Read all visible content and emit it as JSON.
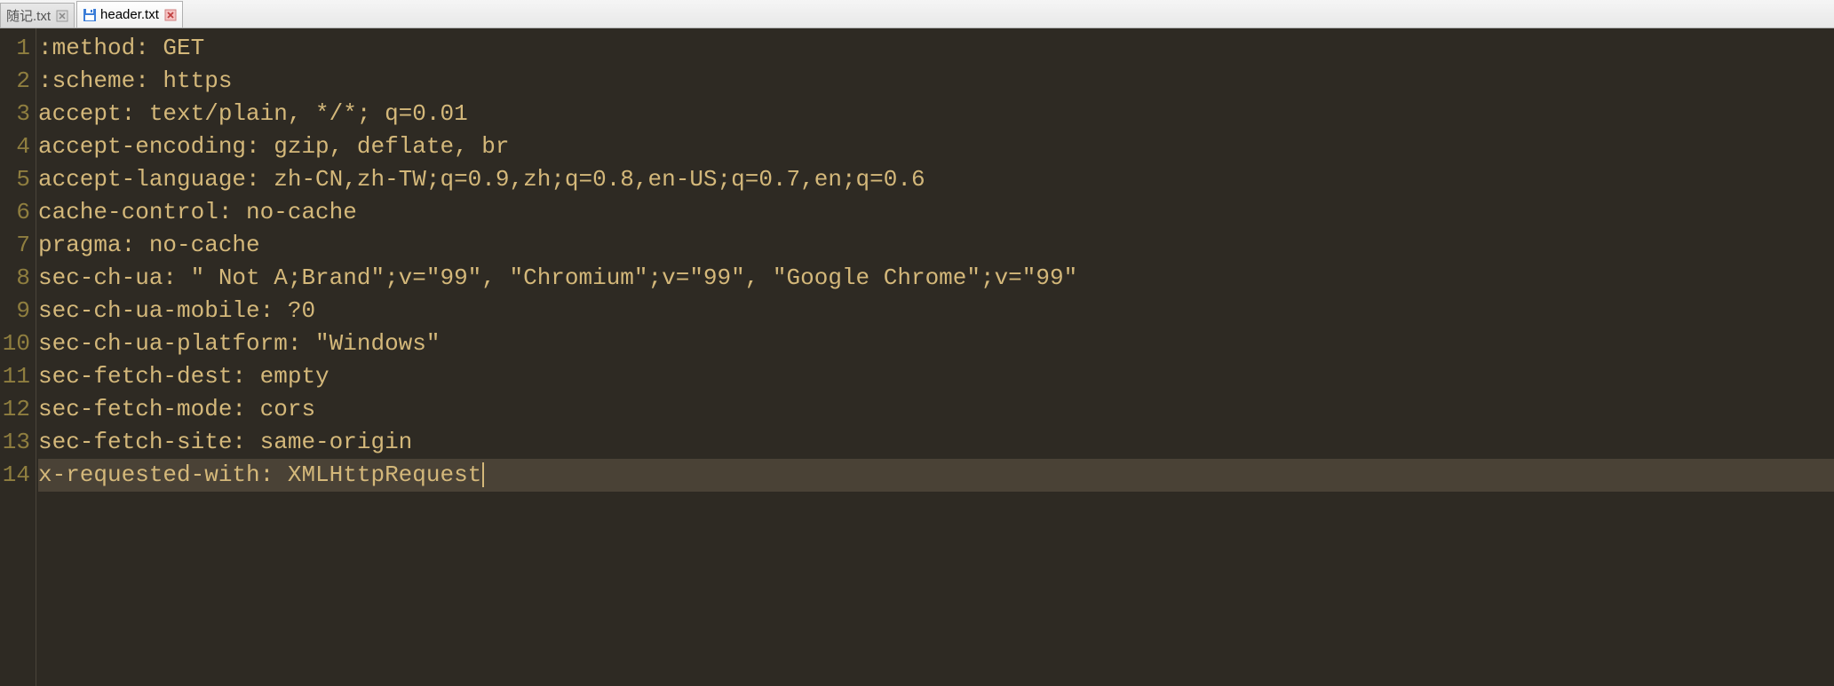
{
  "tabs": [
    {
      "label": "随记.txt",
      "active": false,
      "has_save_icon": false
    },
    {
      "label": "header.txt",
      "active": true,
      "has_save_icon": true
    }
  ],
  "editor": {
    "lines": [
      ":method: GET",
      ":scheme: https",
      "accept: text/plain, */*; q=0.01",
      "accept-encoding: gzip, deflate, br",
      "accept-language: zh-CN,zh-TW;q=0.9,zh;q=0.8,en-US;q=0.7,en;q=0.6",
      "cache-control: no-cache",
      "pragma: no-cache",
      "sec-ch-ua: \" Not A;Brand\";v=\"99\", \"Chromium\";v=\"99\", \"Google Chrome\";v=\"99\"",
      "sec-ch-ua-mobile: ?0",
      "sec-ch-ua-platform: \"Windows\"",
      "sec-fetch-dest: empty",
      "sec-fetch-mode: cors",
      "sec-fetch-site: same-origin",
      "x-requested-with: XMLHttpRequest"
    ],
    "current_line_index": 13
  }
}
